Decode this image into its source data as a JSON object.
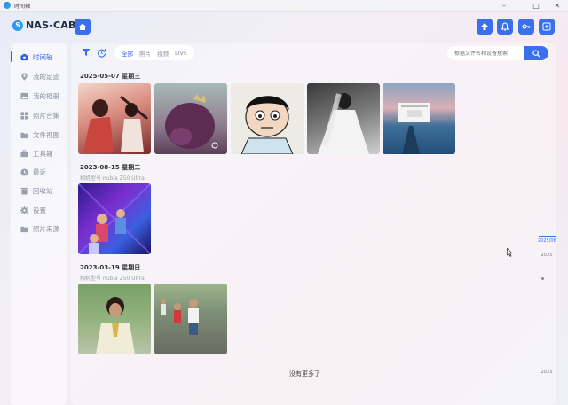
{
  "window": {
    "title": "时间轴"
  },
  "app": {
    "name": "NAS-CAB",
    "logo_letter": "S",
    "accent": "#3a6ff0"
  },
  "sidebar": {
    "items": [
      {
        "label": "时间轴",
        "icon": "camera-icon",
        "active": true
      },
      {
        "label": "我的足迹",
        "icon": "location-icon"
      },
      {
        "label": "我的相册",
        "icon": "album-icon"
      },
      {
        "label": "照片合集",
        "icon": "collection-icon"
      },
      {
        "label": "文件视图",
        "icon": "folder-icon"
      },
      {
        "label": "工具箱",
        "icon": "toolbox-icon"
      },
      {
        "label": "最近",
        "icon": "clock-icon"
      },
      {
        "label": "回收站",
        "icon": "trash-icon"
      },
      {
        "label": "设置",
        "icon": "gear-icon"
      },
      {
        "label": "照片来源",
        "icon": "folder-source-icon"
      }
    ]
  },
  "toolbar": {
    "tabs": [
      "全部",
      "照片",
      "视频",
      "LIVE"
    ],
    "search_placeholder": "根据文件名和设备搜索"
  },
  "groups": [
    {
      "date": "2025-05-07 星期三",
      "device": "",
      "count": 5
    },
    {
      "date": "2023-08-15 星期二",
      "device": "相机型号  nubia Z50 Ultra",
      "count": 1
    },
    {
      "date": "2023-03-19 星期日",
      "device": "相机型号  nubia Z50 Ultra",
      "count": 2
    }
  ],
  "footer": {
    "no_more": "没有更多了"
  },
  "timeline": {
    "labels": [
      "2025/06",
      "2025",
      "2023"
    ]
  }
}
